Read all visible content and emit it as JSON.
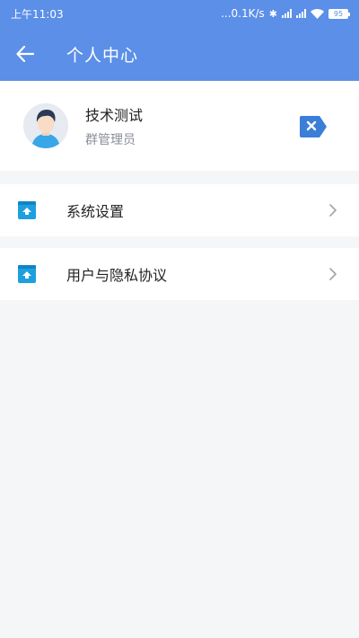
{
  "status_bar": {
    "time": "上午11:03",
    "network_speed": "...0.1K/s",
    "battery": "95"
  },
  "header": {
    "title": "个人中心",
    "back_icon": "arrow-left-icon"
  },
  "profile": {
    "name": "技术测试",
    "role": "群管理员",
    "avatar_icon": "user-avatar",
    "action_icon": "close-tag-icon"
  },
  "menu": [
    {
      "label": "系统设置",
      "icon": "upload-book-icon"
    },
    {
      "label": "用户与隐私协议",
      "icon": "upload-book-icon"
    }
  ],
  "colors": {
    "header": "#5b8fe8",
    "accent": "#3b7ed8",
    "background": "#f5f6f8"
  }
}
